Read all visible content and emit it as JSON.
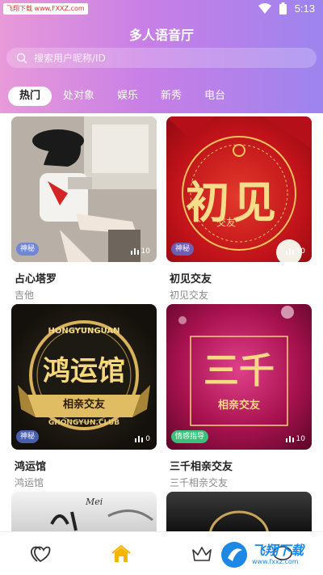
{
  "status": {
    "watermark": "飞翔下载 www.FXXZ.com",
    "time": "5:13"
  },
  "header": {
    "title": "多人语音厅",
    "search_placeholder": "搜索用户昵称/ID"
  },
  "tabs": [
    {
      "label": "热门",
      "active": true
    },
    {
      "label": "处对象",
      "active": false
    },
    {
      "label": "娱乐",
      "active": false
    },
    {
      "label": "新秀",
      "active": false
    },
    {
      "label": "电台",
      "active": false
    }
  ],
  "rooms": [
    {
      "title": "占心塔罗",
      "subtitle": "吉他",
      "badge": "神秘",
      "listeners": "10"
    },
    {
      "title": "初见交友",
      "subtitle": "初见交友",
      "badge": "神秘",
      "listeners": "10",
      "art_text": "初见",
      "art_small": "交友"
    },
    {
      "title": "鸿运馆",
      "subtitle": "鸿运馆",
      "badge": "神秘",
      "listeners": "0",
      "art_top": "HONGYUNGUAN",
      "art_main": "鸿运馆",
      "art_sub": "相亲交友",
      "art_url": "GHONGYUN.CLUB"
    },
    {
      "title": "三千相亲交友",
      "subtitle": "三千相亲交友",
      "badge": "情感指导",
      "listeners": "10",
      "art_main": "三千",
      "art_sub": "相亲交友"
    },
    {
      "title": "",
      "subtitle": "",
      "art_text": "Mei"
    }
  ],
  "bottom_nav": [
    "heart-icon",
    "home-icon",
    "crown-icon",
    "chat-icon"
  ],
  "watermark_bottom": {
    "big": "飞翔下载",
    "small": "www.fxxz.com"
  },
  "colors": {
    "header_start": "#e89ad9",
    "header_end": "#9d84ee",
    "active_nav": "#f5b400",
    "badge_green": "#39c07a"
  }
}
